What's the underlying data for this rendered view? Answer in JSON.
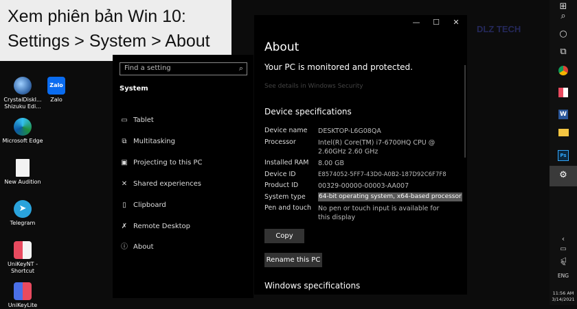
{
  "caption": {
    "line1": "Xem phiên bản Win 10:",
    "line2": "Settings > System > About"
  },
  "desktop_icons": [
    {
      "label": "CrystalDiskI... Shizuku Edi...",
      "icon": "crystaldisk-icon"
    },
    {
      "label": "Zalo",
      "icon": "zalo-icon"
    },
    {
      "label": "Microsoft Edge",
      "icon": "edge-icon"
    },
    {
      "label": "New Audition",
      "icon": "document-icon"
    },
    {
      "label": "Telegram",
      "icon": "telegram-icon"
    },
    {
      "label": "UniKeyNT - Shortcut",
      "icon": "unikey-icon"
    },
    {
      "label": "UniKeyLite",
      "icon": "unikey-icon"
    }
  ],
  "settings": {
    "search_placeholder": "Find a setting",
    "section": "System",
    "nav": [
      {
        "label": "Tablet",
        "icon": "tablet-icon",
        "glyph": "▭"
      },
      {
        "label": "Multitasking",
        "icon": "multitasking-icon",
        "glyph": "⧉"
      },
      {
        "label": "Projecting to this PC",
        "icon": "projecting-icon",
        "glyph": "▣"
      },
      {
        "label": "Shared experiences",
        "icon": "shared-icon",
        "glyph": "✕"
      },
      {
        "label": "Clipboard",
        "icon": "clipboard-icon",
        "glyph": "▯"
      },
      {
        "label": "Remote Desktop",
        "icon": "remote-icon",
        "glyph": "✗"
      },
      {
        "label": "About",
        "icon": "info-icon",
        "glyph": "ⓘ"
      }
    ]
  },
  "about": {
    "title": "About",
    "protected": "Your PC is monitored and protected.",
    "details_link": "See details in Windows Security",
    "device_specs_heading": "Device specifications",
    "specs": [
      {
        "label": "Device name",
        "value": "DESKTOP-L6G08QA"
      },
      {
        "label": "Processor",
        "value": "Intel(R) Core(TM) i7-6700HQ CPU @ 2.60GHz 2.60 GHz"
      },
      {
        "label": "Installed RAM",
        "value": "8.00 GB"
      },
      {
        "label": "Device ID",
        "value": "E8574052-5FF7-43D0-A0B2-187D92C6F7F8"
      },
      {
        "label": "Product ID",
        "value": "00329-00000-00003-AA007"
      },
      {
        "label": "System type",
        "value": "64-bit operating system, x64-based processor"
      },
      {
        "label": "Pen and touch",
        "value": "No pen or touch input is available for this display"
      }
    ],
    "copy_button": "Copy",
    "rename_button": "Rename this PC",
    "windows_specs_heading": "Windows specifications"
  },
  "watermark": "DLZ TECH",
  "taskbar": {
    "language": "ENG",
    "time": "11:56 AM",
    "date": "3/14/2021"
  },
  "colors": {
    "caption_bg": "#ededed",
    "highlight": "#5a5a5a",
    "desktop_bg": "#0c0c0c"
  }
}
